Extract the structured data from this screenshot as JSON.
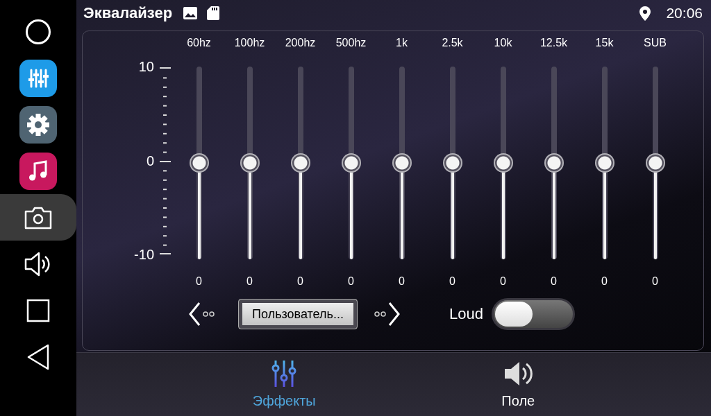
{
  "sidebar": {
    "items": [
      {
        "kind": "home",
        "selected": false
      },
      {
        "kind": "equalizer-app",
        "selected": false
      },
      {
        "kind": "settings-app",
        "selected": false
      },
      {
        "kind": "music-app",
        "selected": false
      },
      {
        "kind": "camera",
        "selected": true
      },
      {
        "kind": "volume",
        "selected": false
      },
      {
        "kind": "recents",
        "selected": false
      },
      {
        "kind": "back",
        "selected": false
      }
    ]
  },
  "header": {
    "title": "Эквалайзер",
    "time": "20:06"
  },
  "equalizer": {
    "scale": {
      "max": "10",
      "mid": "0",
      "min": "-10"
    },
    "bands": [
      {
        "label": "60hz",
        "level": 0.5,
        "reading": "0"
      },
      {
        "label": "100hz",
        "level": 0.5,
        "reading": "0"
      },
      {
        "label": "200hz",
        "level": 0.5,
        "reading": "0"
      },
      {
        "label": "500hz",
        "level": 0.5,
        "reading": "0"
      },
      {
        "label": "1k",
        "level": 0.5,
        "reading": "0"
      },
      {
        "label": "2.5k",
        "level": 0.5,
        "reading": "0"
      },
      {
        "label": "10k",
        "level": 0.5,
        "reading": "0"
      },
      {
        "label": "12.5k",
        "level": 0.5,
        "reading": "0"
      },
      {
        "label": "15k",
        "level": 0.5,
        "reading": "0"
      },
      {
        "label": "SUB",
        "level": 0.5,
        "reading": "0"
      }
    ],
    "preset": "Пользователь...",
    "loud": {
      "label": "Loud",
      "on": false
    }
  },
  "tabs": [
    {
      "label": "Эффекты",
      "kind": "effects",
      "selected": true
    },
    {
      "label": "Поле",
      "kind": "field",
      "selected": false
    }
  ]
}
